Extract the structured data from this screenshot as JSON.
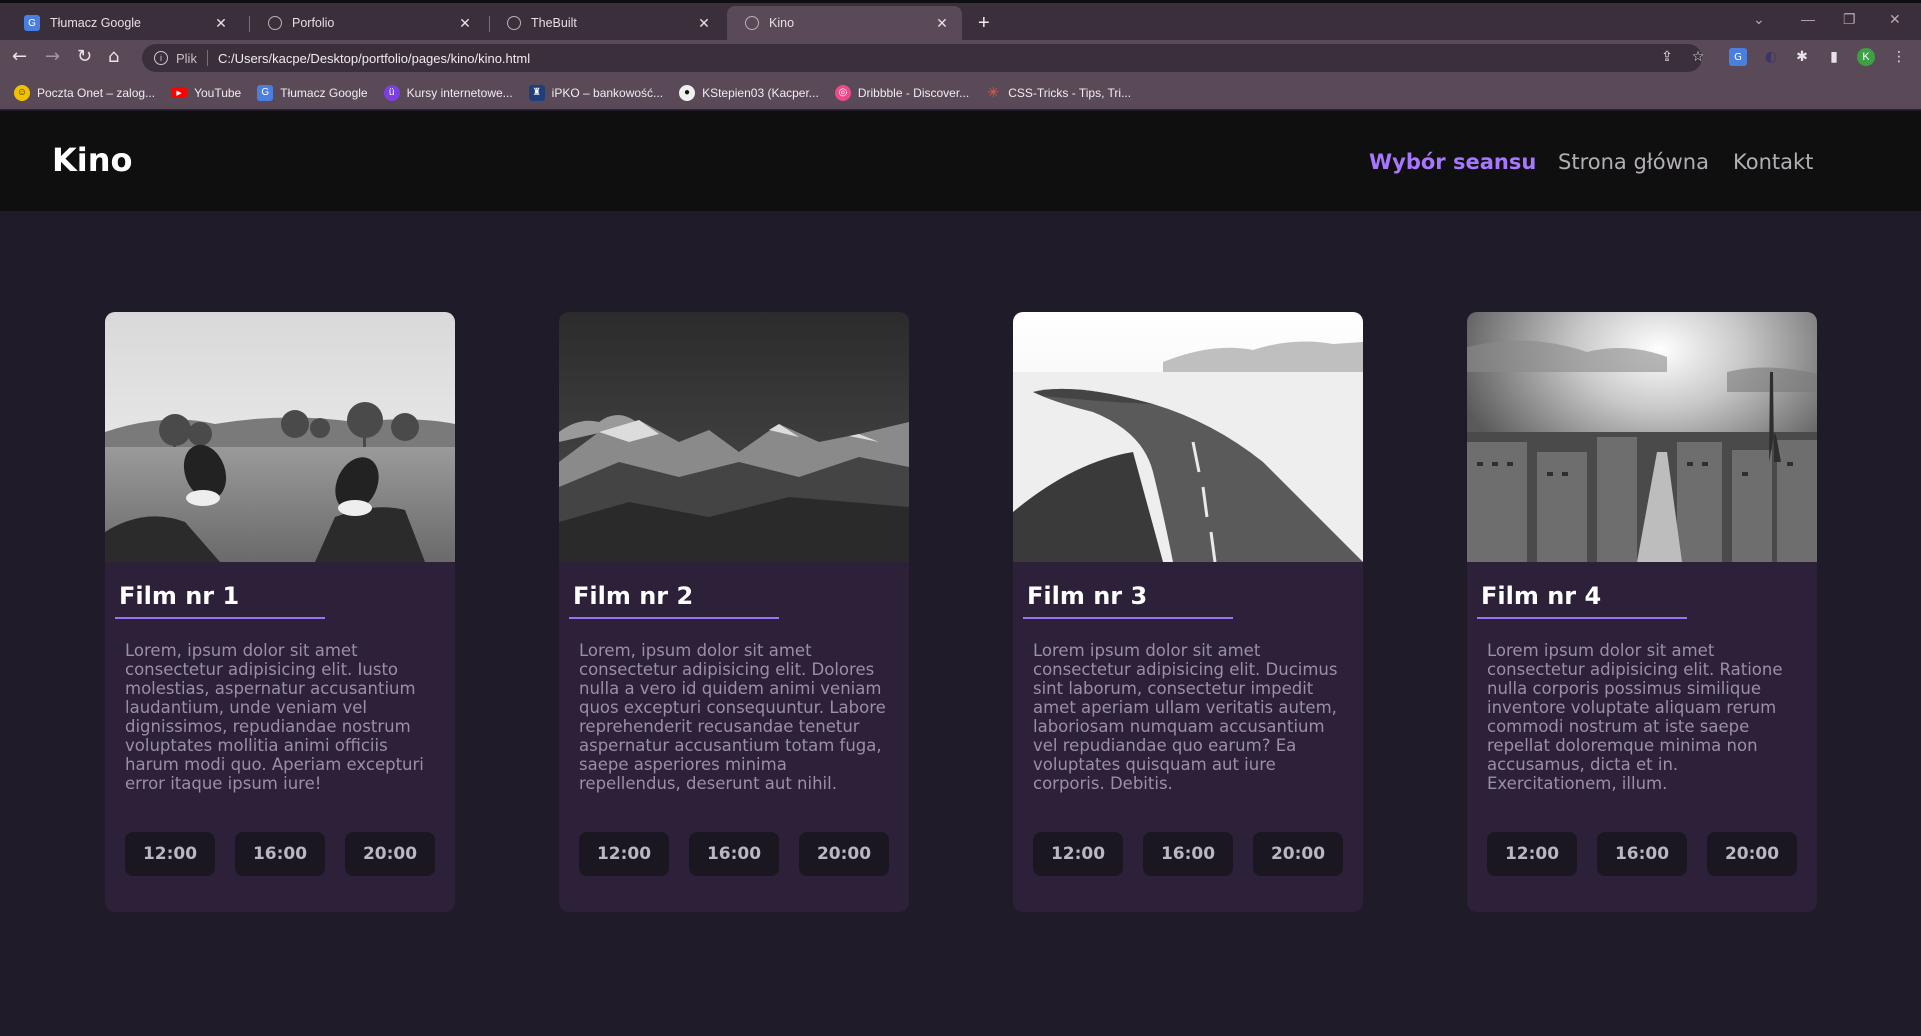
{
  "browser": {
    "tabs": [
      {
        "title": "Tłumacz Google",
        "icon": "google-translate-icon",
        "active": false
      },
      {
        "title": "Porfolio",
        "icon": "globe-icon",
        "active": false
      },
      {
        "title": "TheBuilt",
        "icon": "globe-icon",
        "active": false
      },
      {
        "title": "Kino",
        "icon": "globe-icon",
        "active": true
      }
    ],
    "new_tab": "+",
    "address": {
      "scheme_label": "Plik",
      "url": "C:/Users/kacpe/Desktop/portfolio/pages/kino/kino.html"
    },
    "profile_initial": "K",
    "bookmarks": [
      {
        "label": "Poczta Onet – zalog...",
        "icon": "onet-icon",
        "color": "#f2c200"
      },
      {
        "label": "YouTube",
        "icon": "youtube-icon",
        "color": "#ff0000"
      },
      {
        "label": "Tłumacz Google",
        "icon": "google-translate-icon",
        "color": "#4a7fe0"
      },
      {
        "label": "Kursy internetowe...",
        "icon": "kursy-icon",
        "color": "#7b3fe4"
      },
      {
        "label": "iPKO – bankowość...",
        "icon": "pko-icon",
        "color": "#1e3f7a"
      },
      {
        "label": "KStepien03 (Kacper...",
        "icon": "github-icon",
        "color": "#111111"
      },
      {
        "label": "Dribbble - Discover...",
        "icon": "dribbble-icon",
        "color": "#ea4c89"
      },
      {
        "label": "CSS-Tricks - Tips, Tri...",
        "icon": "css-tricks-icon",
        "color": "#e9573f"
      }
    ]
  },
  "site": {
    "logo": "Kino",
    "nav": [
      {
        "label": "Wybór seansu",
        "active": true
      },
      {
        "label": "Strona główna",
        "active": false
      },
      {
        "label": "Kontakt",
        "active": false
      }
    ],
    "accent_color": "#a777ff"
  },
  "films": [
    {
      "title": "Film nr 1",
      "image": "sneakers-on-grass-photo",
      "description": "Lorem, ipsum dolor sit amet consectetur adipisicing elit. Iusto molestias, aspernatur accusantium laudantium, unde veniam vel dignissimos, repudiandae nostrum voluptates mollitia animi officiis harum modi quo. Aperiam excepturi error itaque ipsum iure!",
      "times": [
        "12:00",
        "16:00",
        "20:00"
      ]
    },
    {
      "title": "Film nr 2",
      "image": "mountains-photo",
      "description": "Lorem, ipsum dolor sit amet consectetur adipisicing elit. Dolores nulla a vero id quidem animi veniam quos excepturi consequuntur. Labore reprehenderit recusandae tenetur aspernatur accusantium totam fuga, saepe asperiores minima repellendus, deserunt aut nihil.",
      "times": [
        "12:00",
        "16:00",
        "20:00"
      ]
    },
    {
      "title": "Film nr 3",
      "image": "snowy-road-photo",
      "description": "Lorem ipsum dolor sit amet consectetur adipisicing elit. Ducimus sint laborum, consectetur impedit amet aperiam ullam veritatis autem, laboriosam numquam accusantium vel repudiandae quo earum? Ea voluptates quisquam aut iure corporis. Debitis.",
      "times": [
        "12:00",
        "16:00",
        "20:00"
      ]
    },
    {
      "title": "Film nr 4",
      "image": "paris-skyline-photo",
      "description": "Lorem ipsum dolor sit amet consectetur adipisicing elit. Ratione nulla corporis possimus similique inventore voluptate aliquam rerum commodi nostrum at iste saepe repellat doloremque minima non accusamus, dicta et in. Exercitationem, illum.",
      "times": [
        "12:00",
        "16:00",
        "20:00"
      ]
    }
  ]
}
